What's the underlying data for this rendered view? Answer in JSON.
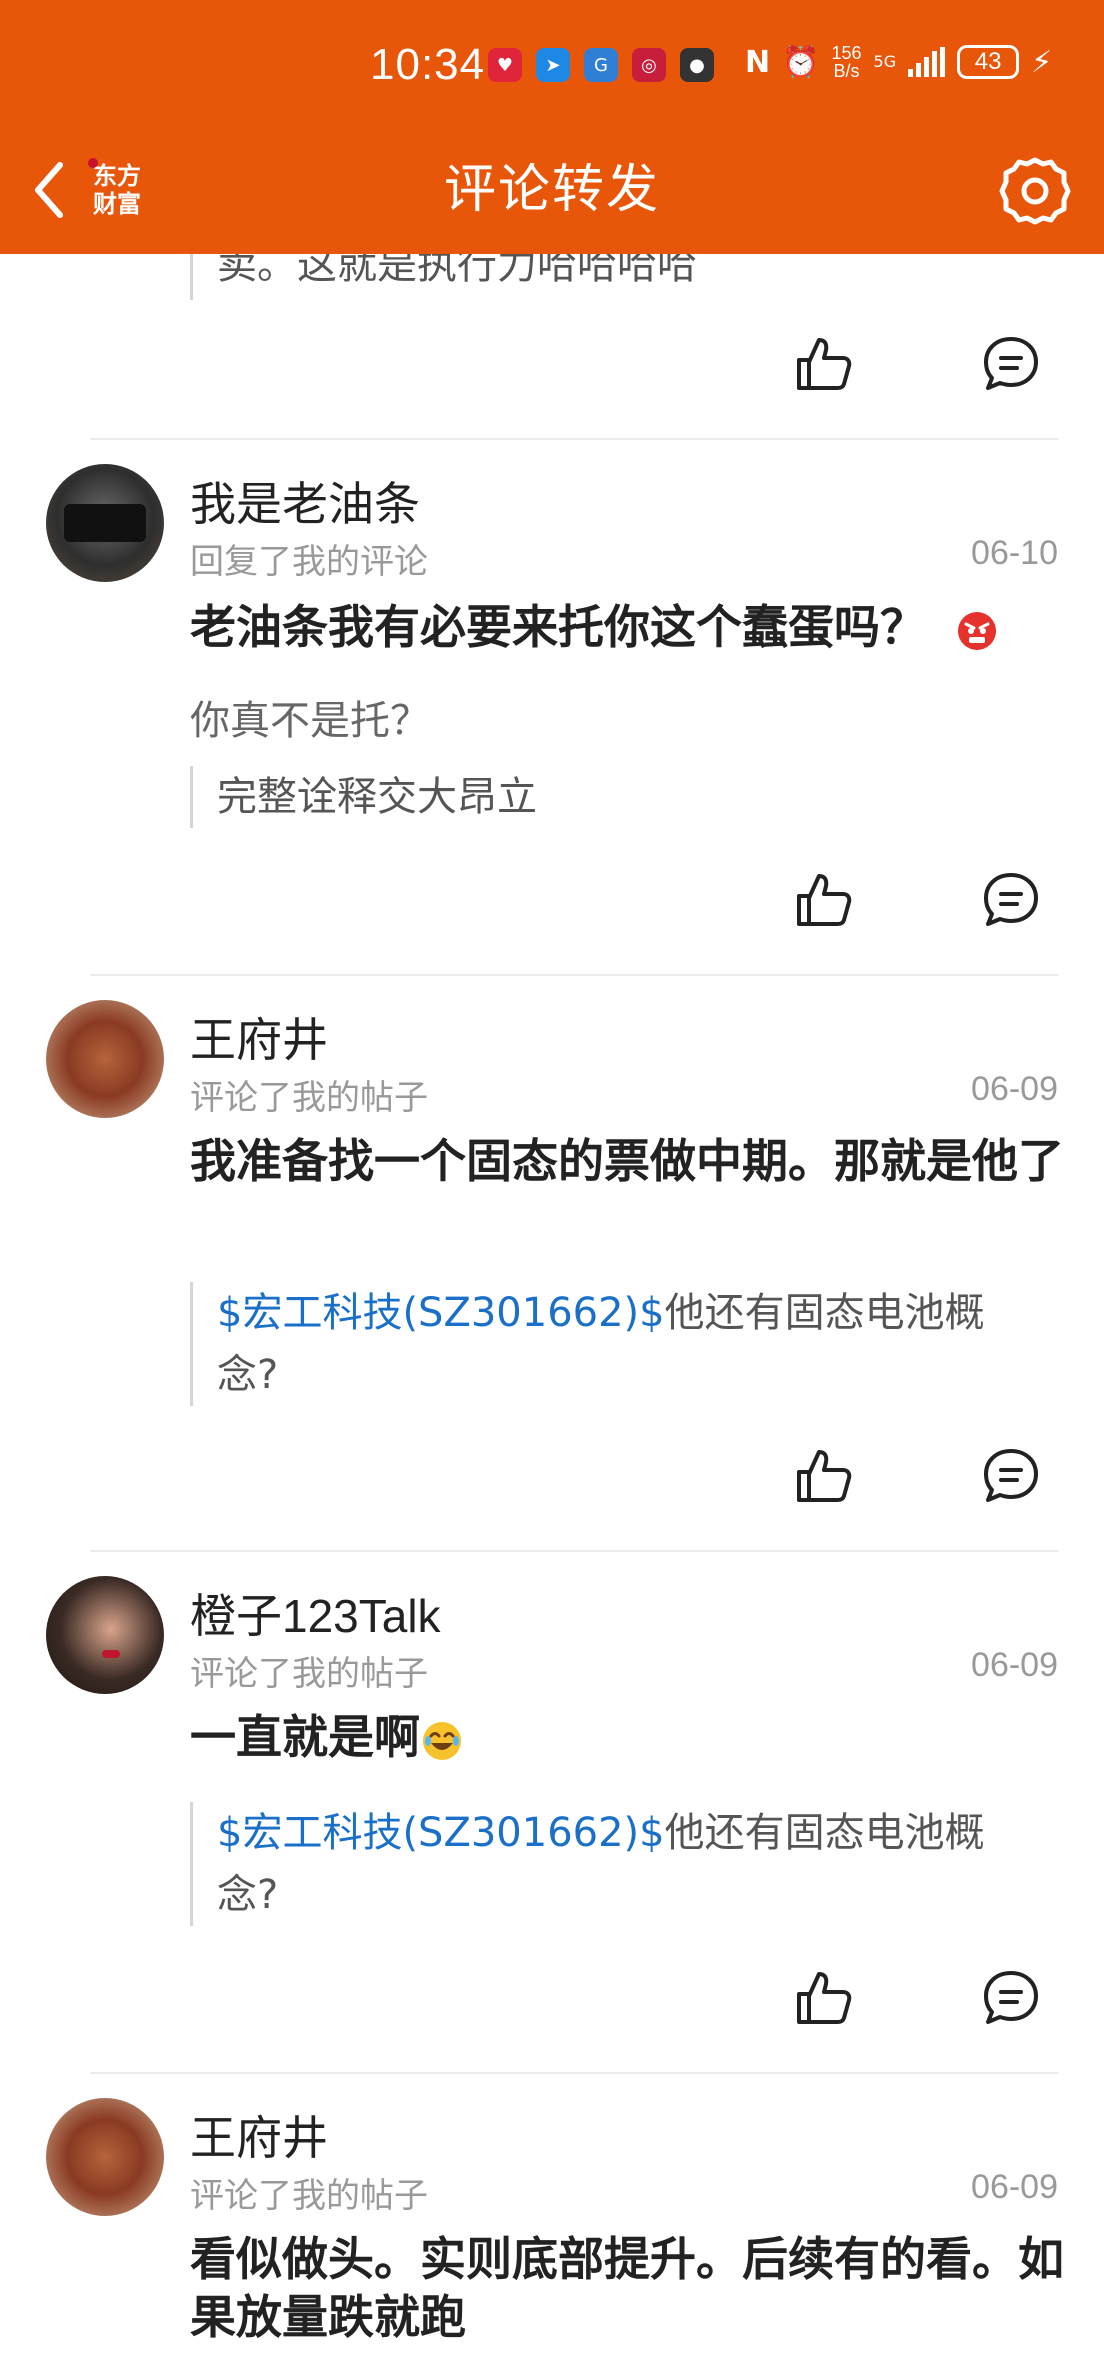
{
  "status_bar": {
    "time": "10:34",
    "net_speed_top": "156",
    "net_speed_bottom": "B/s",
    "network": "5G",
    "battery": "43"
  },
  "header": {
    "title": "评论转发",
    "logo_line1": "东方",
    "logo_line2": "财富"
  },
  "colors": {
    "brand": "#e8560a",
    "link": "#1a6fc8"
  },
  "top_partial": {
    "quote": "卖。这就是执行力哈哈哈哈"
  },
  "comments": [
    {
      "username": "我是老油条",
      "action": "回复了我的评论",
      "date": "06-10",
      "main": "老油条我有必要来托你这个蠢蛋吗？",
      "sub": "你真不是托？",
      "quote_text": "完整诠释交大昂立"
    },
    {
      "username": "王府井",
      "action": "评论了我的帖子",
      "date": "06-09",
      "main": "我准备找一个固态的票做中期。那就是他了",
      "quote_stock": "$宏工科技(SZ301662)$",
      "quote_text": "他还有固态电池概念?"
    },
    {
      "username": "橙子123Talk",
      "action": "评论了我的帖子",
      "date": "06-09",
      "main": "一直就是啊",
      "quote_stock": "$宏工科技(SZ301662)$",
      "quote_text": "他还有固态电池概念?"
    },
    {
      "username": "王府井",
      "action": "评论了我的帖子",
      "date": "06-09",
      "main": "看似做头。实则底部提升。后续有的看。如果放量跌就跑"
    }
  ]
}
